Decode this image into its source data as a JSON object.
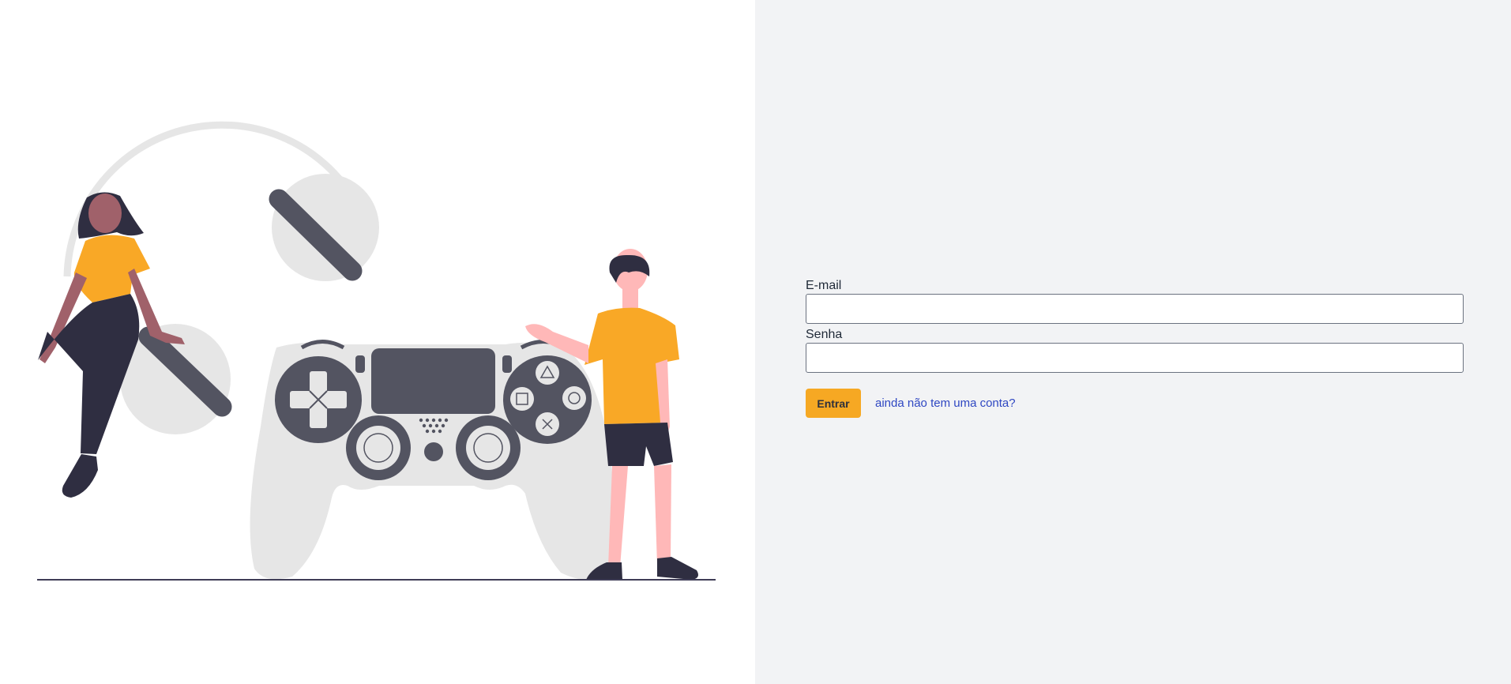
{
  "form": {
    "email_label": "E-mail",
    "email_value": "",
    "password_label": "Senha",
    "password_value": "",
    "submit_label": "Entrar",
    "signup_link": "ainda não tem uma conta?"
  },
  "illustration": {
    "subject": "gamepad-illustration"
  },
  "colors": {
    "accent": "#f6a823",
    "link": "#2f47c2",
    "panel_background": "#f2f3f5",
    "illustration_dark": "#535461",
    "illustration_light": "#e6e6e6"
  }
}
